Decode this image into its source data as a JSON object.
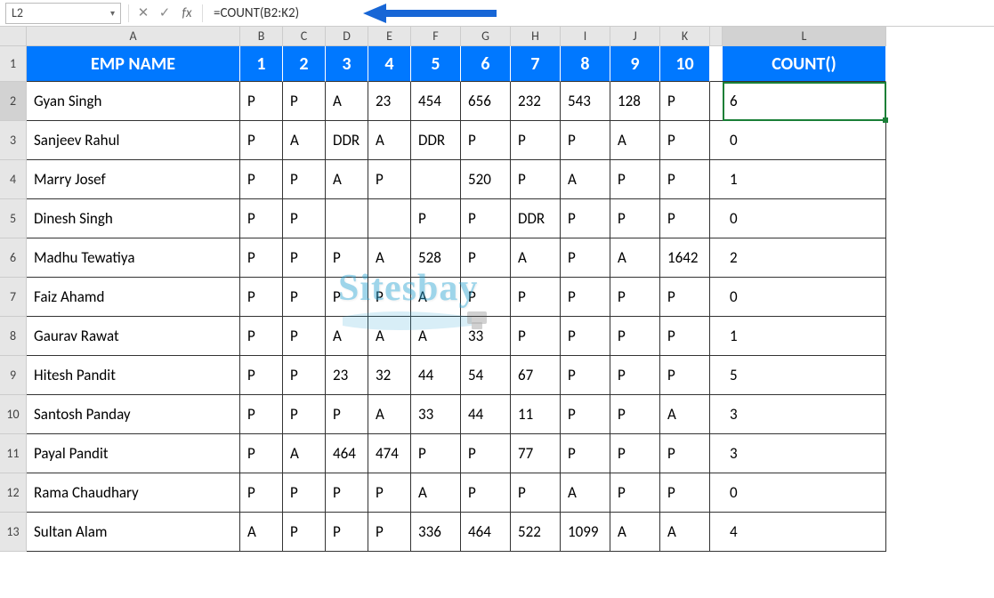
{
  "formula_bar": {
    "name_box": "L2",
    "fx_label": "fx",
    "formula": "=COUNT(B2:K2)"
  },
  "col_letters": [
    "",
    "A",
    "B",
    "C",
    "D",
    "E",
    "F",
    "G",
    "H",
    "I",
    "J",
    "K",
    "",
    "L"
  ],
  "header": {
    "name": "EMP NAME",
    "nums": [
      "1",
      "2",
      "3",
      "4",
      "5",
      "6",
      "7",
      "8",
      "9",
      "10"
    ],
    "count": "COUNT()"
  },
  "rows": [
    {
      "rh": "2",
      "name": "Gyan Singh",
      "vals": [
        "P",
        "P",
        "A",
        "23",
        "454",
        "656",
        "232",
        "543",
        "128",
        "P"
      ],
      "count": "6",
      "selected": true
    },
    {
      "rh": "3",
      "name": "Sanjeev Rahul",
      "vals": [
        "P",
        "A",
        "DDR",
        "A",
        "DDR",
        "P",
        "P",
        "P",
        "A",
        "P"
      ],
      "count": "0"
    },
    {
      "rh": "4",
      "name": "Marry Josef",
      "vals": [
        "P",
        "P",
        "A",
        "P",
        "",
        "520",
        "P",
        "A",
        "P",
        "P"
      ],
      "count": "1"
    },
    {
      "rh": "5",
      "name": "Dinesh Singh",
      "vals": [
        "P",
        "P",
        "",
        "",
        "P",
        "P",
        "DDR",
        "P",
        "P",
        "P"
      ],
      "count": "0"
    },
    {
      "rh": "6",
      "name": "Madhu Tewatiya",
      "vals": [
        "P",
        "P",
        "P",
        "A",
        "528",
        "P",
        "A",
        "P",
        "A",
        "1642"
      ],
      "count": "2"
    },
    {
      "rh": "7",
      "name": "Faiz Ahamd",
      "vals": [
        "P",
        "P",
        "P",
        "P",
        "A",
        "P",
        "P",
        "P",
        "P",
        "P"
      ],
      "count": "0"
    },
    {
      "rh": "8",
      "name": "Gaurav Rawat",
      "vals": [
        "P",
        "P",
        "A",
        "A",
        "A",
        "33",
        "P",
        "P",
        "P",
        "P"
      ],
      "count": "1"
    },
    {
      "rh": "9",
      "name": "Hitesh Pandit",
      "vals": [
        "P",
        "P",
        "23",
        "32",
        "44",
        "54",
        "67",
        "P",
        "P",
        "P"
      ],
      "count": "5"
    },
    {
      "rh": "10",
      "name": "Santosh Panday",
      "vals": [
        "P",
        "P",
        "P",
        "A",
        "33",
        "44",
        "11",
        "P",
        "P",
        "A"
      ],
      "count": "3"
    },
    {
      "rh": "11",
      "name": "Payal Pandit",
      "vals": [
        "P",
        "A",
        "464",
        "474",
        "P",
        "P",
        "77",
        "P",
        "P",
        "P"
      ],
      "count": "3"
    },
    {
      "rh": "12",
      "name": "Rama Chaudhary",
      "vals": [
        "P",
        "P",
        "P",
        "P",
        "A",
        "P",
        "P",
        "A",
        "P",
        "P"
      ],
      "count": "0"
    },
    {
      "rh": "13",
      "name": "Sultan Alam",
      "vals": [
        "A",
        "P",
        "P",
        "P",
        "336",
        "464",
        "522",
        "1099",
        "A",
        "A"
      ],
      "count": "4"
    }
  ],
  "watermark": "Sitesbay",
  "chart_data": {
    "type": "table",
    "title": "Excel COUNT() example",
    "columns": [
      "EMP NAME",
      "1",
      "2",
      "3",
      "4",
      "5",
      "6",
      "7",
      "8",
      "9",
      "10",
      "COUNT()"
    ],
    "rows": [
      [
        "Gyan Singh",
        "P",
        "P",
        "A",
        23,
        454,
        656,
        232,
        543,
        128,
        "P",
        6
      ],
      [
        "Sanjeev Rahul",
        "P",
        "A",
        "DDR",
        "A",
        "DDR",
        "P",
        "P",
        "P",
        "A",
        "P",
        0
      ],
      [
        "Marry Josef",
        "P",
        "P",
        "A",
        "P",
        "",
        520,
        "P",
        "A",
        "P",
        "P",
        1
      ],
      [
        "Dinesh Singh",
        "P",
        "P",
        "",
        "",
        "P",
        "P",
        "DDR",
        "P",
        "P",
        "P",
        0
      ],
      [
        "Madhu Tewatiya",
        "P",
        "P",
        "P",
        "A",
        528,
        "P",
        "A",
        "P",
        "A",
        1642,
        2
      ],
      [
        "Faiz Ahamd",
        "P",
        "P",
        "P",
        "P",
        "A",
        "P",
        "P",
        "P",
        "P",
        "P",
        0
      ],
      [
        "Gaurav Rawat",
        "P",
        "P",
        "A",
        "A",
        "A",
        33,
        "P",
        "P",
        "P",
        "P",
        1
      ],
      [
        "Hitesh Pandit",
        "P",
        "P",
        23,
        32,
        44,
        54,
        67,
        "P",
        "P",
        "P",
        5
      ],
      [
        "Santosh Panday",
        "P",
        "P",
        "P",
        "A",
        33,
        44,
        11,
        "P",
        "P",
        "A",
        3
      ],
      [
        "Payal Pandit",
        "P",
        "A",
        464,
        474,
        "P",
        "P",
        77,
        "P",
        "P",
        "P",
        3
      ],
      [
        "Rama Chaudhary",
        "P",
        "P",
        "P",
        "P",
        "A",
        "P",
        "P",
        "A",
        "P",
        "P",
        0
      ],
      [
        "Sultan Alam",
        "A",
        "P",
        "P",
        "P",
        336,
        464,
        522,
        1099,
        "A",
        "A",
        4
      ]
    ],
    "formula_shown": "=COUNT(B2:K2)"
  }
}
